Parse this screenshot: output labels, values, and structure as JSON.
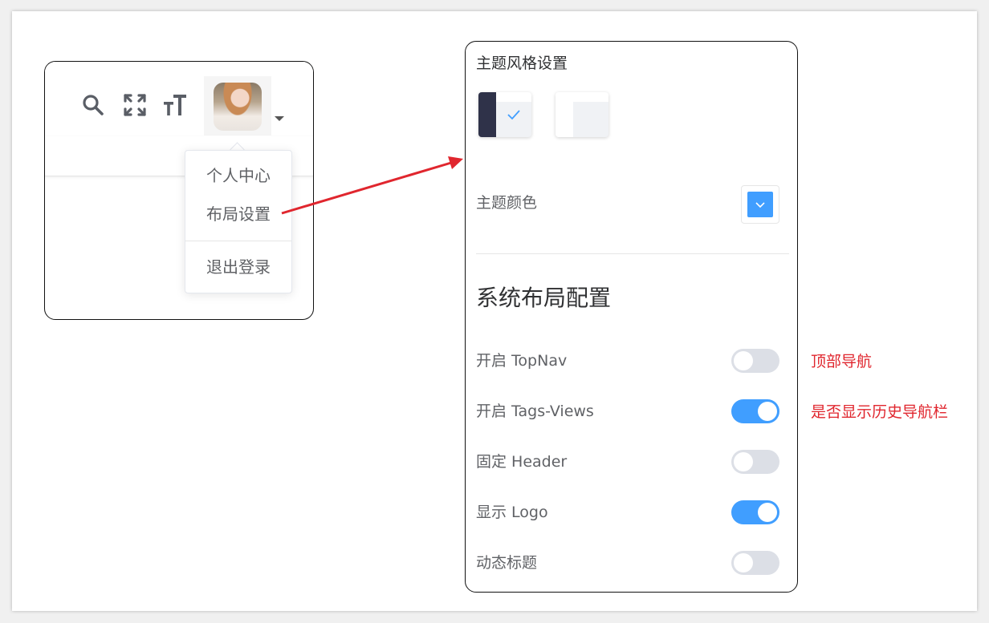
{
  "navbar": {
    "icons": [
      "search-icon",
      "fullscreen-icon",
      "font-size-icon"
    ],
    "avatar_icon": "user-avatar"
  },
  "dropdown": {
    "items": [
      "个人中心",
      "布局设置",
      "退出登录"
    ]
  },
  "settings": {
    "title": "主题风格设置",
    "theme_options": [
      {
        "name": "dark",
        "selected": true
      },
      {
        "name": "light",
        "selected": false
      }
    ],
    "theme_color_label": "主题颜色",
    "theme_color": "#409eff",
    "layout_heading": "系统布局配置",
    "toggles": [
      {
        "label": "开启 TopNav",
        "on": false
      },
      {
        "label": "开启 Tags-Views",
        "on": true
      },
      {
        "label": "固定 Header",
        "on": false
      },
      {
        "label": "显示 Logo",
        "on": true
      },
      {
        "label": "动态标题",
        "on": false
      }
    ]
  },
  "annotations": {
    "topnav": "顶部导航",
    "tags_views": "是否显示历史导航栏",
    "color": "#e0262e"
  },
  "colors": {
    "primary": "#409eff",
    "sidebar_dark": "#2f3249",
    "switch_off": "#dcdfe6"
  }
}
